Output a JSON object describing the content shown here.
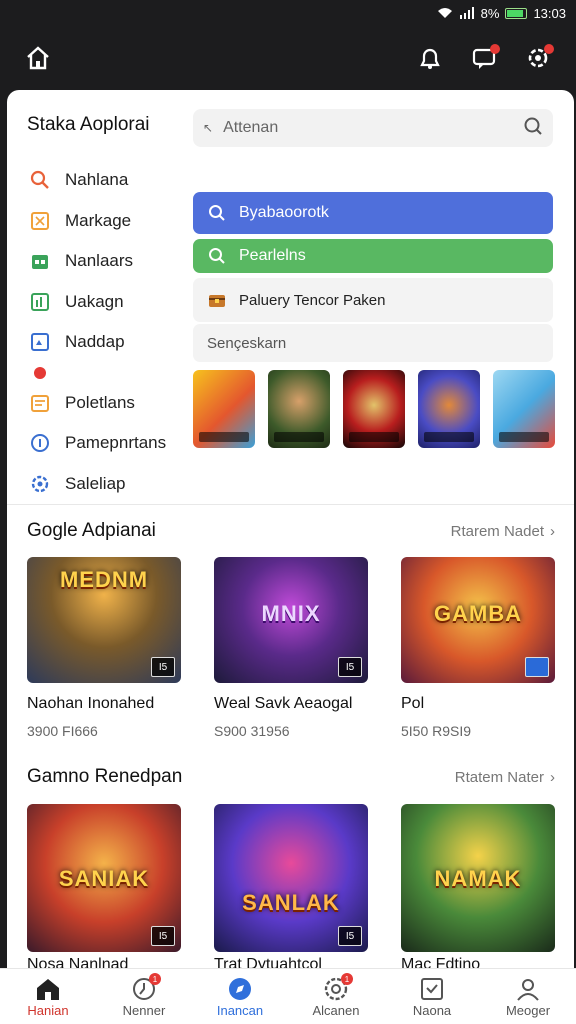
{
  "status": {
    "battery": "8%",
    "time": "13:03"
  },
  "sidebar": {
    "title": "Staka Aoplorai",
    "items": [
      {
        "label": "Nahlana",
        "icon": "search-icon",
        "color": "#e8623a"
      },
      {
        "label": "Markage",
        "icon": "puzzle-icon",
        "color": "#f0a13a"
      },
      {
        "label": "Nanlaars",
        "icon": "calendar-icon",
        "color": "#3aa35a"
      },
      {
        "label": "Uakagn",
        "icon": "chart-icon",
        "color": "#3aa35a"
      },
      {
        "label": "Naddap",
        "icon": "image-icon",
        "color": "#3a6fd0"
      },
      {
        "label": "",
        "icon": "red-dot-icon",
        "color": "#e53935"
      },
      {
        "label": "Poletlans",
        "icon": "folder-icon",
        "color": "#f0a13a"
      },
      {
        "label": "Pamepnrtans",
        "icon": "info-icon",
        "color": "#3a6fd0"
      },
      {
        "label": "Saleliap",
        "icon": "settings-icon",
        "color": "#3a6fd0"
      }
    ]
  },
  "search": {
    "placeholder": "Attenan"
  },
  "buttons": {
    "blue_label": "Byabaoorotk",
    "green_label": "Pearlelns",
    "grey_label": "Paluery Tencor Paken",
    "grey2_label": "Sençeskarn"
  },
  "sections": [
    {
      "title": "Gogle Adpianai",
      "more": "Rtarem Nadet",
      "cards": [
        {
          "title": "Naohan Inonahed",
          "meta": "3900 FI666",
          "logo": "MEDNM",
          "badge": "I5"
        },
        {
          "title": "Weal Savk Aeaogal",
          "meta": "S900 31956",
          "logo": "MNIX",
          "badge": "I5"
        },
        {
          "title": "Pol",
          "meta": "5I50 R9SI9",
          "logo": "GAMBA",
          "badge": ""
        }
      ]
    },
    {
      "title": "Gamno Renedpan",
      "more": "Rtatem Nater",
      "cards": [
        {
          "title": "Nosa Nanlnad",
          "meta": "",
          "logo": "SANIAK",
          "badge": "I5"
        },
        {
          "title": "Trat Dytuahtcol",
          "meta": "",
          "logo": "SANLAK",
          "badge": "I5"
        },
        {
          "title": "Mac Fdtino",
          "meta": "",
          "logo": "NAMAK",
          "badge": ""
        }
      ]
    }
  ],
  "bottom_nav": [
    {
      "label": "Hanian",
      "icon": "home-icon",
      "badge": ""
    },
    {
      "label": "Nenner",
      "icon": "clock-icon",
      "badge": "1"
    },
    {
      "label": "Inancan",
      "icon": "compass-icon",
      "badge": ""
    },
    {
      "label": "Alcanen",
      "icon": "activity-icon",
      "badge": "1"
    },
    {
      "label": "Naona",
      "icon": "inbox-icon",
      "badge": ""
    },
    {
      "label": "Meoger",
      "icon": "user-icon",
      "badge": ""
    }
  ]
}
